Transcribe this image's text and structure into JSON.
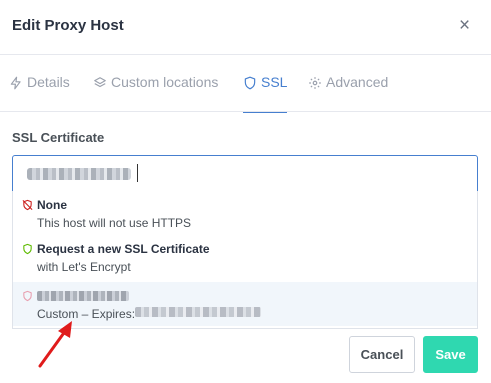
{
  "header": {
    "title": "Edit Proxy Host",
    "close_icon": "×"
  },
  "tabs": [
    {
      "label": "Details",
      "icon": "bolt-icon"
    },
    {
      "label": "Custom locations",
      "icon": "layers-icon"
    },
    {
      "label": "SSL",
      "icon": "shield-icon",
      "active": true
    },
    {
      "label": "Advanced",
      "icon": "gear-icon"
    }
  ],
  "ssl": {
    "label": "SSL Certificate",
    "options": [
      {
        "title": "None",
        "subtitle": "This host will not use HTTPS",
        "icon": "shield-off-icon",
        "icon_color": "#cd201f"
      },
      {
        "title": "Request a new SSL Certificate",
        "subtitle": "with Let's Encrypt",
        "icon": "shield-icon",
        "icon_color": "#5eba00"
      },
      {
        "subtitle": "Custom – Expires:",
        "icon": "shield-icon",
        "icon_color": "#e8a0b0"
      }
    ]
  },
  "footer": {
    "cancel_label": "Cancel",
    "save_label": "Save"
  },
  "colors": {
    "accent": "#467fcf",
    "save": "#2fd8b0",
    "annotation_arrow": "#e01b1b"
  }
}
